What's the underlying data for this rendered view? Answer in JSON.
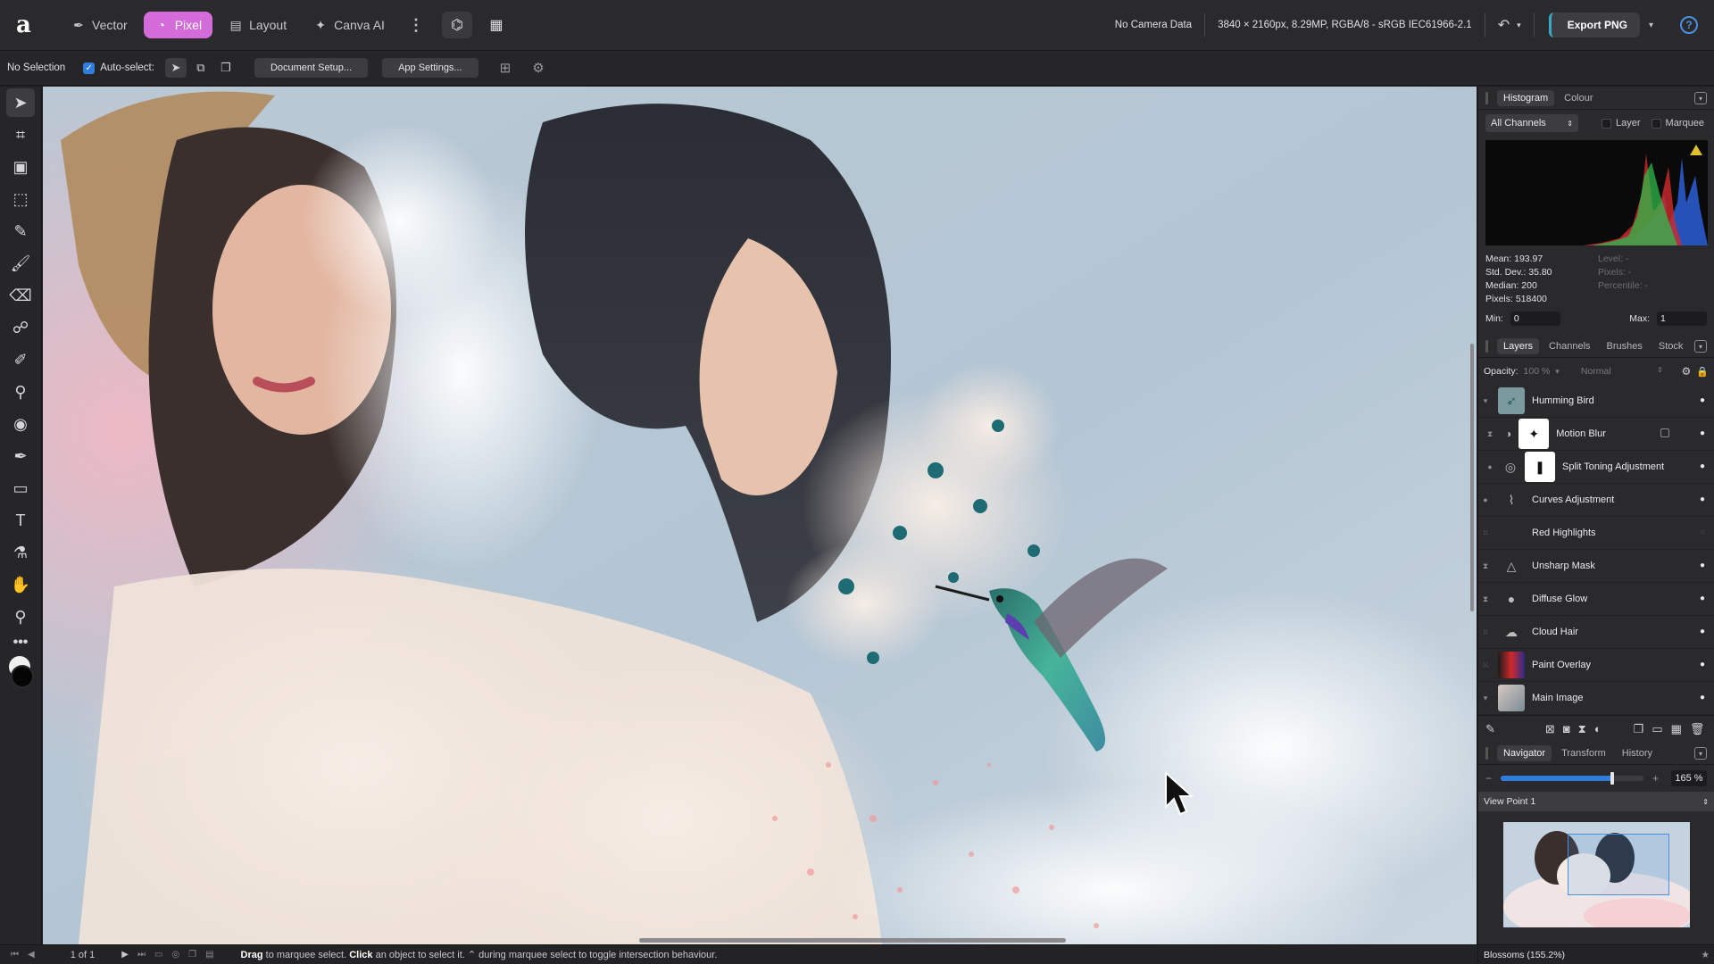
{
  "topbar": {
    "personas": [
      {
        "label": "Vector",
        "icon": "pen-nib-icon",
        "active": false
      },
      {
        "label": "Pixel",
        "icon": "pixel-drop-icon",
        "active": true
      },
      {
        "label": "Layout",
        "icon": "layout-icon",
        "active": false
      },
      {
        "label": "Canva AI",
        "icon": "sparkle-icon",
        "active": false
      }
    ],
    "camera": "No Camera Data",
    "document_info": "3840 × 2160px, 8.29MP, RGBA/8 - sRGB IEC61966-2.1",
    "export_label": "Export PNG",
    "help": "?"
  },
  "context": {
    "selection": "No Selection",
    "auto_select": "Auto-select:",
    "auto_select_checked": true,
    "document_setup": "Document Setup...",
    "app_settings": "App Settings..."
  },
  "tools": [
    "move-tool-icon",
    "crop-tool-icon",
    "artboard-tool-icon",
    "marquee-tool-icon",
    "selection-brush-icon",
    "paint-brush-icon",
    "eraser-icon",
    "smudge-brush-icon",
    "retouch-brush-icon",
    "clone-stamp-icon",
    "dodge-burn-icon",
    "pen-tool-icon",
    "rectangle-tool-icon",
    "text-tool-icon",
    "color-picker-icon",
    "hand-tool-icon",
    "zoom-tool-icon"
  ],
  "status": {
    "pages": "1 of 1",
    "hint_bold1": "Drag",
    "hint_text1": " to marquee select. ",
    "hint_bold2": "Click",
    "hint_text2": " an object to select it. ",
    "hint_text3": "⌃ during marquee select to toggle intersection behaviour."
  },
  "histogram": {
    "tabs": [
      "Histogram",
      "Colour"
    ],
    "channels": "All Channels",
    "layer_label": "Layer",
    "marquee_label": "Marquee",
    "mean": "Mean: 193.97",
    "std_dev": "Std. Dev.: 35.80",
    "median": "Median: 200",
    "pixels": "Pixels: 518400",
    "level": "Level: -",
    "pixels_right": "Pixels: -",
    "percentile": "Percentile: -",
    "min_label": "Min:",
    "min_value": "0",
    "max_label": "Max:",
    "max_value": "1"
  },
  "layers_panel": {
    "tabs": [
      "Layers",
      "Channels",
      "Brushes",
      "Stock"
    ],
    "opacity_label": "Opacity:",
    "opacity_value": "100 %",
    "blend_mode": "Normal",
    "layers": [
      {
        "name": "Humming Bird",
        "child": false,
        "visible": true
      },
      {
        "name": "Motion Blur",
        "child": true,
        "visible": true
      },
      {
        "name": "Split Toning Adjustment",
        "child": true,
        "visible": true
      },
      {
        "name": "Curves Adjustment",
        "child": false,
        "visible": true
      },
      {
        "name": "Red Highlights",
        "child": false,
        "visible": false
      },
      {
        "name": "Unsharp Mask",
        "child": false,
        "visible": true
      },
      {
        "name": "Diffuse Glow",
        "child": false,
        "visible": true
      },
      {
        "name": "Cloud Hair",
        "child": false,
        "visible": true
      },
      {
        "name": "Paint Overlay",
        "child": false,
        "visible": true
      },
      {
        "name": "Main Image",
        "child": false,
        "visible": true
      }
    ]
  },
  "navigator": {
    "tabs": [
      "Navigator",
      "Transform",
      "History"
    ],
    "zoom": "165 %",
    "zoom_fraction": 0.78,
    "view_point": "View Point 1",
    "footer": "Blossoms (155.2%)"
  },
  "colors": {
    "accent": "#d36bd8",
    "select_blue": "#2f7de0",
    "export_accent": "#3ca8c8"
  }
}
